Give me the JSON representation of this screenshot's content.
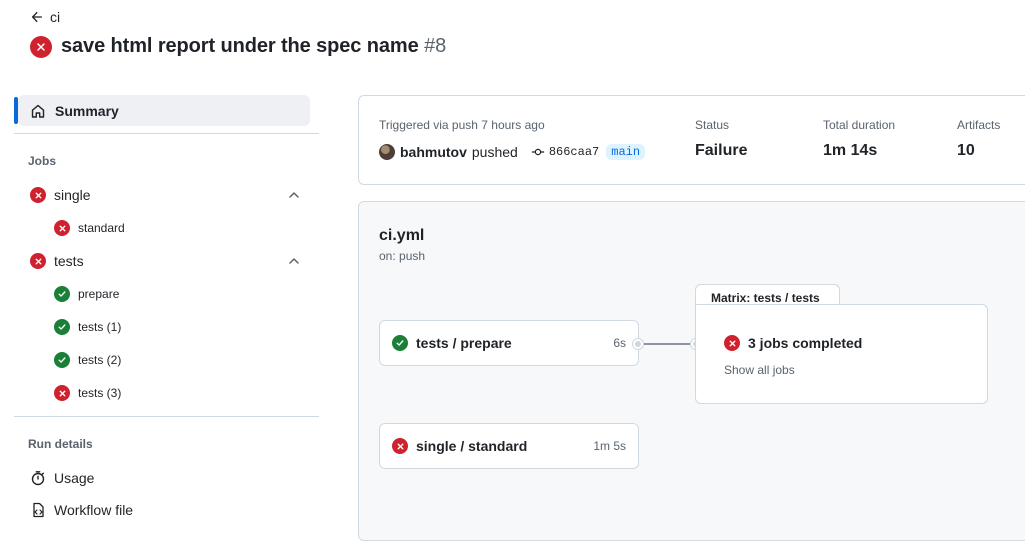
{
  "header": {
    "back_label": "ci",
    "title": "save html report under the spec name",
    "run_number": "#8"
  },
  "sidebar": {
    "summary_label": "Summary",
    "jobs_heading": "Jobs",
    "groups": [
      {
        "label": "single",
        "status": "failure",
        "children": [
          {
            "label": "standard",
            "status": "failure"
          }
        ]
      },
      {
        "label": "tests",
        "status": "failure",
        "children": [
          {
            "label": "prepare",
            "status": "success"
          },
          {
            "label": "tests (1)",
            "status": "success"
          },
          {
            "label": "tests (2)",
            "status": "success"
          },
          {
            "label": "tests (3)",
            "status": "failure"
          }
        ]
      }
    ],
    "run_details_heading": "Run details",
    "usage_label": "Usage",
    "workflow_file_label": "Workflow file"
  },
  "summary": {
    "trigger_text": "Triggered via push 7 hours ago",
    "actor": "bahmutov",
    "action": "pushed",
    "commit": "866caa7",
    "branch": "main",
    "status_label": "Status",
    "status_value": "Failure",
    "duration_label": "Total duration",
    "duration_value": "1m 14s",
    "artifacts_label": "Artifacts",
    "artifacts_value": "10"
  },
  "graph": {
    "workflow_file": "ci.yml",
    "trigger": "on: push",
    "nodes": [
      {
        "label": "tests / prepare",
        "duration": "6s",
        "status": "success"
      },
      {
        "label": "single / standard",
        "duration": "1m 5s",
        "status": "failure"
      }
    ],
    "matrix": {
      "tab_label": "Matrix: tests / tests",
      "summary": "3 jobs completed",
      "link": "Show all jobs",
      "status": "failure"
    }
  },
  "colors": {
    "failure": "#cf222e",
    "success": "#1a7f37",
    "accent": "#0969da"
  }
}
